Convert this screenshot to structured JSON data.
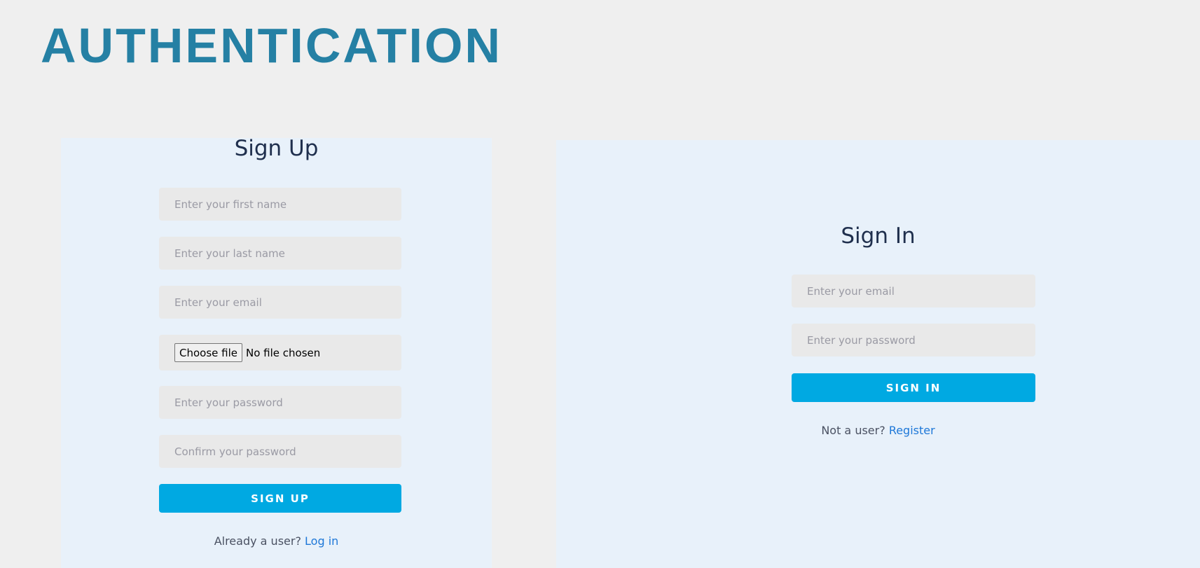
{
  "page": {
    "title": "AUTHENTICATION"
  },
  "signup": {
    "heading": "Sign Up",
    "first_name_placeholder": "Enter your first name",
    "last_name_placeholder": "Enter your last name",
    "email_placeholder": "Enter your email",
    "file_button_label": "Choose file",
    "file_status": "No file chosen",
    "password_placeholder": "Enter your password",
    "confirm_password_placeholder": "Confirm your password",
    "submit_label": "SIGN UP",
    "footer_text": "Already a user?",
    "footer_link": "Log in"
  },
  "signin": {
    "heading": "Sign In",
    "email_placeholder": "Enter your email",
    "password_placeholder": "Enter your password",
    "submit_label": "SIGN IN",
    "footer_text": "Not a user?",
    "footer_link": "Register"
  },
  "colors": {
    "title": "#2580a4",
    "panel": "#e8f1fa",
    "field": "#e9e9e9",
    "button": "#00a9e2",
    "link": "#1e78d8"
  }
}
